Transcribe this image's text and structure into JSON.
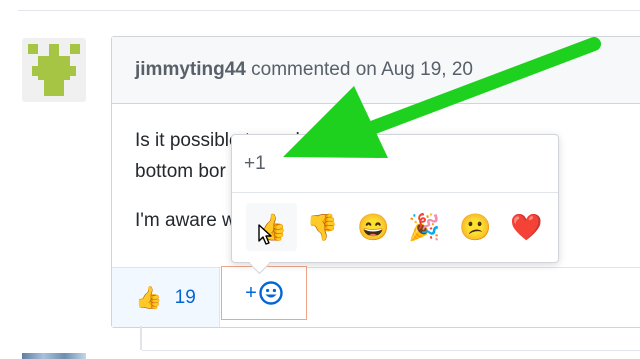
{
  "comment": {
    "author": "jimmyting44",
    "header_suffix": " commented on Aug 19, 20",
    "paragraphs": [
      "Is it possible to                              such that the",
      "bottom bor",
      "I'm aware                                        works hor"
    ]
  },
  "reactions": {
    "thumbs_up_emoji": "👍",
    "thumbs_up_count": "19",
    "add_plus": "+",
    "add_icon": "smiley-icon"
  },
  "popover": {
    "title": "+1",
    "emojis": [
      {
        "name": "thumbs-up",
        "glyph": "👍"
      },
      {
        "name": "thumbs-down",
        "glyph": "👎"
      },
      {
        "name": "laugh",
        "glyph": "😄"
      },
      {
        "name": "hooray",
        "glyph": "🎉"
      },
      {
        "name": "confused",
        "glyph": "😕"
      },
      {
        "name": "heart",
        "glyph": "❤️"
      }
    ]
  },
  "colors": {
    "arrow": "#1ed11e",
    "link_blue": "#0366d6",
    "highlight_border": "#f0a58a",
    "avatar_green": "#a6c545"
  }
}
